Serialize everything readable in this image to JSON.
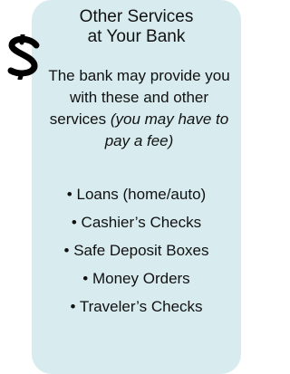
{
  "header": {
    "title_line1": "Other Services",
    "title_line2": "at Your Bank"
  },
  "intro": {
    "text": "The bank may provide you with these and other services ",
    "note": "(you may have to pay a fee)"
  },
  "services": [
    "Loans (home/auto)",
    "Cashier’s Checks",
    "Safe Deposit Boxes",
    "Money Orders",
    "Traveler’s Checks"
  ],
  "colors": {
    "card_background": "#d8ecf0",
    "text": "#111111",
    "dollar_icon": "#000000"
  },
  "icon": "dollar-sign-icon"
}
